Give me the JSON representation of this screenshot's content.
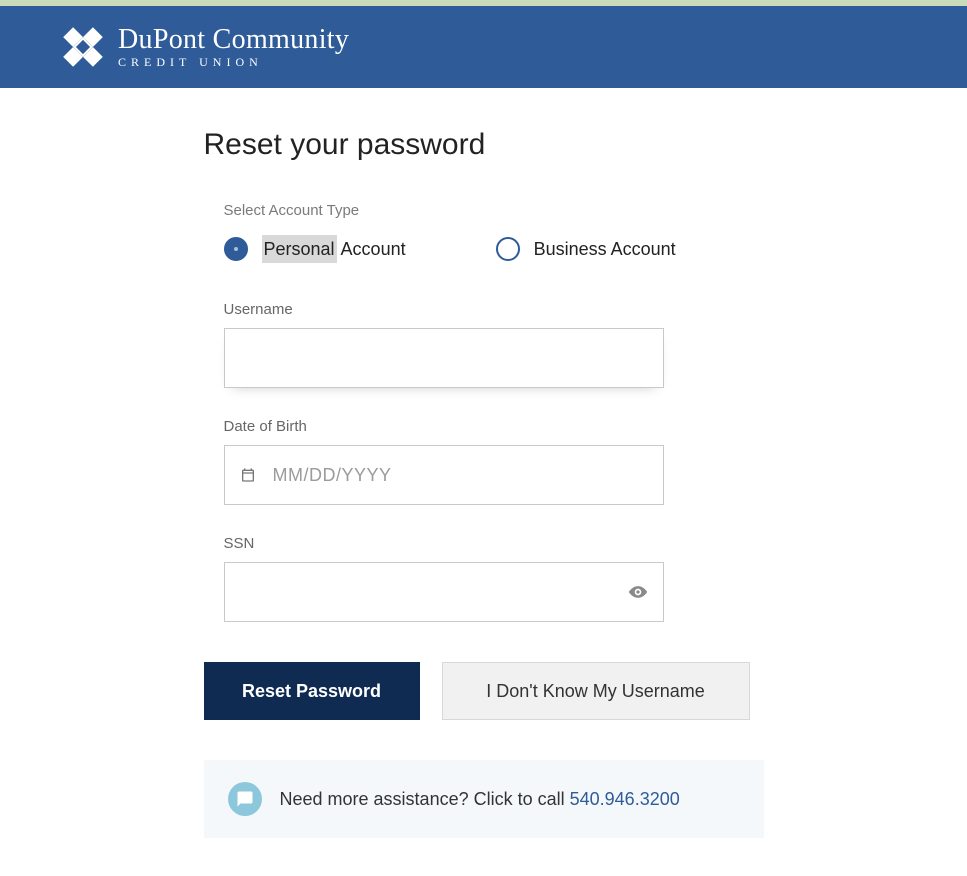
{
  "brand": {
    "line1": "DuPont Community",
    "line2": "CREDIT UNION"
  },
  "page": {
    "title": "Reset your password"
  },
  "form": {
    "accountTypeLabel": "Select Account Type",
    "radios": {
      "personal_pre": "Personal",
      "personal_post": " Account",
      "business": "Business Account"
    },
    "username": {
      "label": "Username",
      "value": ""
    },
    "dob": {
      "label": "Date of Birth",
      "placeholder": "MM/DD/YYYY",
      "value": ""
    },
    "ssn": {
      "label": "SSN",
      "value": ""
    }
  },
  "buttons": {
    "primary": "Reset Password",
    "secondary": "I Don't Know My Username"
  },
  "assist": {
    "text": "Need more assistance? Click to call ",
    "phone": "540.946.3200"
  }
}
